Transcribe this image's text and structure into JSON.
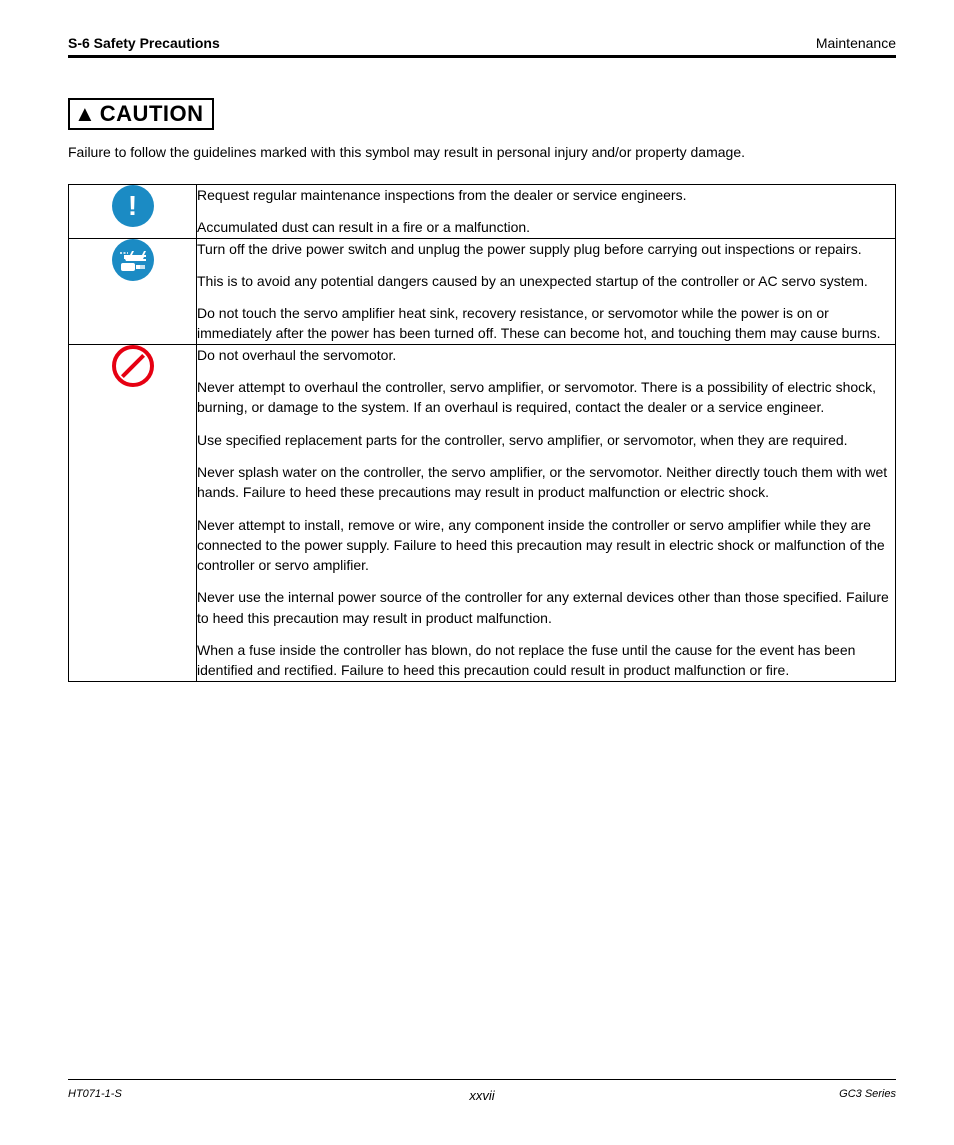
{
  "header": {
    "left": "S-6 Safety Precautions",
    "right": "Maintenance"
  },
  "caution": {
    "signal_word": "CAUTION",
    "desc": "Failure to follow the guidelines marked with this symbol may result in personal injury and/or property damage."
  },
  "rows": [
    {
      "paragraphs": [
        "Request regular maintenance inspections from the dealer or service engineers.",
        "Accumulated dust can result in a fire or a malfunction."
      ]
    },
    {
      "paragraphs": [
        "Turn off the drive power switch and unplug the power supply plug before carrying out inspections or repairs.",
        "This is to avoid any potential dangers caused by an unexpected startup of the controller or AC servo system.",
        "Do not touch the servo amplifier heat sink, recovery resistance, or servomotor while the power is on or immediately after the power has been turned off. These can become hot, and touching them may cause burns."
      ]
    },
    {
      "paragraphs": [
        "Do not overhaul the servomotor.",
        "Never attempt to overhaul the controller, servo amplifier, or servomotor. There is a possibility of electric shock, burning, or damage to the system. If an overhaul is required, contact the dealer or a service engineer.",
        "Use specified replacement parts for the controller, servo amplifier, or servomotor, when they are required.",
        "Never splash water on the controller, the servo amplifier, or the servomotor. Neither directly touch them with wet hands. Failure to heed these precautions may result in product malfunction or electric shock.",
        "Never attempt to install, remove or wire, any component inside the controller or servo amplifier while they are connected to the power supply. Failure to heed this precaution may result in electric shock or malfunction of the controller or servo amplifier.",
        "Never use the internal power source of the controller for any external devices other than those specified. Failure to heed this precaution may result in product malfunction.",
        "When a fuse inside the controller has blown, do not replace the fuse until the cause for the event has been identified and rectified. Failure to heed this precaution could result in product malfunction or fire."
      ]
    }
  ],
  "footer": {
    "left": "HT071-1-S",
    "page": "xxvii",
    "right": "GC3 Series"
  }
}
